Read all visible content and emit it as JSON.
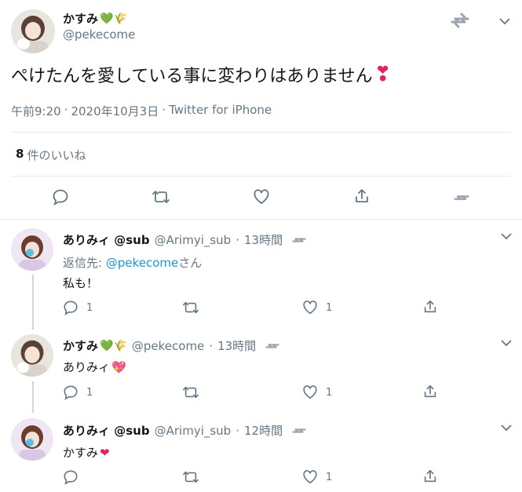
{
  "main_tweet": {
    "author_name": "かすみ",
    "author_emoji": "💚🌾",
    "handle": "@pekecome",
    "text": "ぺけたんを愛している事に変わりはありません",
    "text_emoji": "❣",
    "time": "午前9:20",
    "date": "2020年10月3日",
    "client": "Twitter for iPhone",
    "dot": "·",
    "likes_count": "8",
    "likes_label": "件のいいね"
  },
  "replies": [
    {
      "author_name": "ありみィ",
      "author_suffix": "@sub",
      "handle": "@Arimyi_sub",
      "time": "13時間",
      "reply_to_label": "返信先: ",
      "reply_to_handle": "@pekecome",
      "reply_to_suffix": "さん",
      "text": "私も！",
      "text_emoji": "",
      "reply_count": "1",
      "like_count": "1"
    },
    {
      "author_name": "かすみ",
      "author_emoji": "💚🌾",
      "handle": "@pekecome",
      "time": "13時間",
      "text": "ありみィ",
      "text_emoji": "💖",
      "reply_count": "1",
      "like_count": "1"
    },
    {
      "author_name": "ありみィ",
      "author_suffix": "@sub",
      "handle": "@Arimyi_sub",
      "time": "12時間",
      "text": "かすみ",
      "text_emoji": "❤",
      "reply_count": "",
      "like_count": "1"
    }
  ],
  "colors": {
    "link": "#1b95e0",
    "muted": "#657786",
    "divider": "#e6ecf0",
    "heart_red": "#e0245e"
  }
}
